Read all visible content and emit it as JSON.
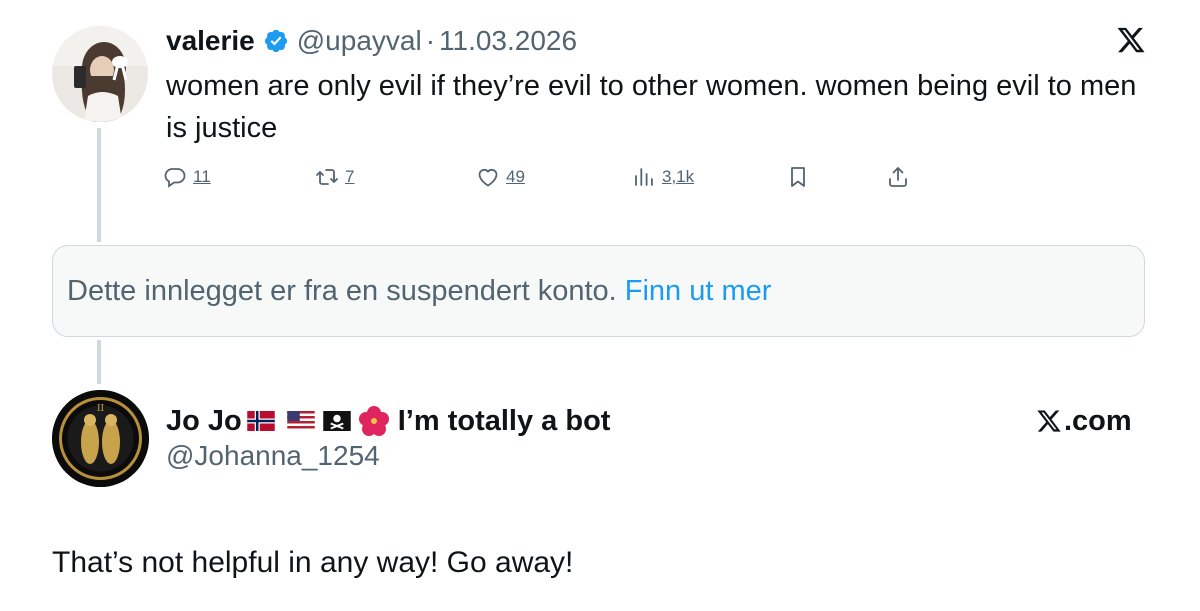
{
  "tweet": {
    "author_name": "valerie",
    "author_handle": "@upayval",
    "separator": "·",
    "date": "11.03.2026",
    "text": "women are only evil if they’re evil to other women. women being evil to men is justice",
    "actions": {
      "replies": "11",
      "reposts": "7",
      "likes": "49",
      "views": "3,1k"
    },
    "icons": [
      "verified-badge-icon",
      "x-logo-icon",
      "reply-icon",
      "repost-icon",
      "like-icon",
      "views-icon",
      "bookmark-icon",
      "share-icon"
    ]
  },
  "suspended_notice": {
    "text": "Dette innlegget er fra en suspendert konto.",
    "link": "Finn ut mer"
  },
  "reply": {
    "author_name": "Jo Jo",
    "author_name_suffix": "I’m totally a bot",
    "emoji": [
      "norway-flag",
      "us-flag",
      "pirate-flag",
      "hibiscus"
    ],
    "author_handle": "@Johanna_1254",
    "text": "That’s not helpful in any way! Go away!",
    "source_label": ".com"
  },
  "colors": {
    "text_primary": "#0f1419",
    "text_secondary": "#536471",
    "link": "#1d9bf0",
    "verified": "#1d9bf0",
    "thread_line": "#cfd9de",
    "notice_bg": "#f7f9f9"
  }
}
